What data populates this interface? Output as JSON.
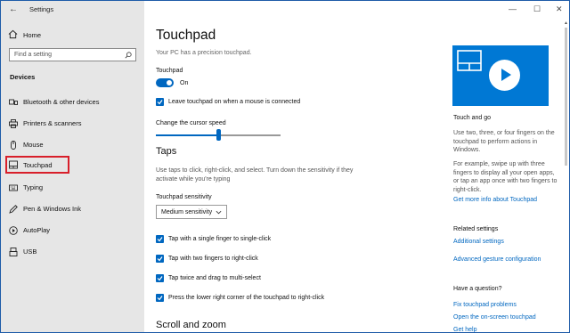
{
  "window": {
    "title": "Settings"
  },
  "sidebar": {
    "home_label": "Home",
    "search_placeholder": "Find a setting",
    "section": "Devices",
    "items": [
      {
        "label": "Bluetooth & other devices",
        "icon": "bluetooth-icon"
      },
      {
        "label": "Printers & scanners",
        "icon": "printer-icon"
      },
      {
        "label": "Mouse",
        "icon": "mouse-icon"
      },
      {
        "label": "Touchpad",
        "icon": "touchpad-icon",
        "selected": true
      },
      {
        "label": "Typing",
        "icon": "keyboard-icon"
      },
      {
        "label": "Pen & Windows Ink",
        "icon": "pen-icon"
      },
      {
        "label": "AutoPlay",
        "icon": "autoplay-icon"
      },
      {
        "label": "USB",
        "icon": "usb-icon"
      }
    ]
  },
  "main": {
    "title": "Touchpad",
    "subtitle": "Your PC has a precision touchpad.",
    "touchpad_label": "Touchpad",
    "toggle_state": "On",
    "leave_on_label": "Leave touchpad on when a mouse is connected",
    "cursor_speed_label": "Change the cursor speed",
    "cursor_speed_value": 0.5,
    "taps": {
      "heading": "Taps",
      "description": "Use taps to click, right-click, and select. Turn down the sensitivity if they activate while you're typing",
      "sensitivity_label": "Touchpad sensitivity",
      "sensitivity_value": "Medium sensitivity",
      "options": [
        "Tap with a single finger to single-click",
        "Tap with two fingers to right-click",
        "Tap twice and drag to multi-select",
        "Press the lower right corner of the touchpad to right-click"
      ]
    },
    "scroll_heading": "Scroll and zoom"
  },
  "right": {
    "touch_go_heading": "Touch and go",
    "touch_go_text": "Use two, three, or four fingers on the touchpad to perform actions in Windows.",
    "example_text": "For example, swipe up with three fingers to display all your open apps, or tap an app once with two fingers to right-click.",
    "more_info_link": "Get more info about Touchpad",
    "related_heading": "Related settings",
    "additional_link": "Additional settings",
    "advanced_link": "Advanced gesture configuration",
    "question_heading": "Have a question?",
    "fix_link": "Fix touchpad problems",
    "keyboard_link": "Open the on-screen touchpad",
    "help_link": "Get help"
  },
  "colors": {
    "accent": "#0067c0",
    "sidebar_bg": "#e6e6e6",
    "selection_outline": "#d81f2a",
    "video_bg": "#0078d4"
  }
}
